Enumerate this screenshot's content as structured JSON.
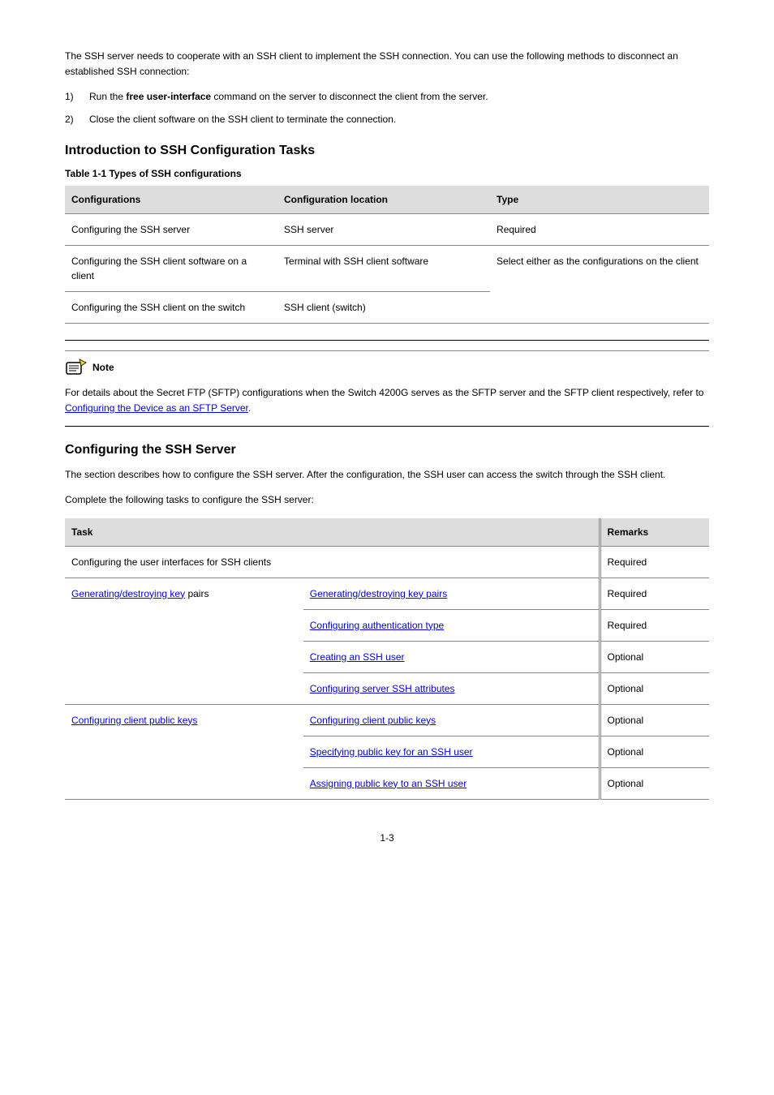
{
  "intro": {
    "p1": "The SSH server needs to cooperate with an SSH client to implement the SSH connection. You can use the following methods to disconnect an established SSH connection:",
    "items": [
      {
        "n": "1)",
        "text_prefix": "Run the ",
        "bold": "free user-interface",
        "text_suffix": " command on the server to disconnect the client from the server."
      },
      {
        "n": "2)",
        "text_prefix": "Close the client software on the SSH client to terminate the connection.",
        "bold": "",
        "text_suffix": ""
      }
    ]
  },
  "section1": {
    "heading": "Introduction to SSH Configuration Tasks",
    "table_caption": "Table 1-1 Types of SSH configurations",
    "table": {
      "headers": [
        "Configurations",
        "Configuration location",
        "Type"
      ],
      "rows": [
        [
          "Configuring the SSH server",
          "SSH server",
          "Required"
        ],
        [
          "Configuring the SSH client software on a client",
          "Terminal with SSH client software",
          "Select either as the configurations on the client"
        ],
        [
          "Configuring the SSH client on the switch",
          "SSH client (switch)",
          ""
        ]
      ]
    },
    "note_label": "Note",
    "note_p1": "For details about the Secret FTP (SFTP) configurations when the Switch 4200G serves as the SFTP server and the SFTP client respectively, refer to",
    "note_link": "Configuring the Device as an SFTP Server",
    "note_p2": "."
  },
  "section2": {
    "heading": "Configuring the SSH Server",
    "p1": "The section describes how to configure the SSH server. After the configuration, the SSH user can access the switch through the SSH client.",
    "p2": "Complete the following tasks to configure the SSH server:",
    "table": {
      "headers": [
        "Task",
        "",
        "Remarks"
      ],
      "rows": [
        {
          "task": "Configuring the user interfaces for SSH clients",
          "colspan": 2,
          "remarks": "Required"
        },
        {
          "task_link": "Generating/destroying key pairs",
          "sub_link": "Generating/destroying key pairs",
          "remarks": "Required"
        },
        {
          "task": "",
          "sub_link": "Configuring authentication type",
          "remarks": "Required"
        },
        {
          "task": "",
          "sub_link": "Creating an SSH user",
          "remarks": "Optional"
        },
        {
          "task": "",
          "sub_link": "Configuring server SSH attributes",
          "remarks": "Optional"
        },
        {
          "task_link": "Configuring client public keys",
          "sub_link": "Configuring client public keys",
          "remarks": "Optional"
        },
        {
          "task": "",
          "sub_link": "Specifying public key for an SSH user",
          "remarks": "Optional"
        },
        {
          "task": "",
          "sub_link": "Assigning public key to an SSH user",
          "remarks": "Optional"
        }
      ]
    }
  },
  "complete_table2": {
    "header_task": "Task",
    "header_remarks": "Remarks",
    "rows": [
      {
        "col1": "Configuring the user interfaces for SSH clients",
        "col2": "",
        "col3": "Required",
        "span": true
      },
      {
        "col1_link": "Generating/destroying key",
        "col1_plain": "pairs",
        "col2_link": "Generating/destroying key pairs",
        "col3": "Required"
      },
      {
        "col1": "",
        "col2_link": "Configuring authentication type",
        "col3": "Required"
      },
      {
        "col1": "",
        "col2_link": "Creating an SSH user",
        "col3": "Optional"
      },
      {
        "col1": "",
        "col2_link": "Configuring server SSH attributes",
        "col3": "Optional"
      },
      {
        "col1_link": "Configuring client public keys",
        "col2_link": "Configuring client public keys",
        "col3": "Optional"
      },
      {
        "col1": "",
        "col2_link": "Specifying public key for an SSH user",
        "col3": "Optional"
      },
      {
        "col1": "",
        "col2_link": "Assigning public key to an SSH user",
        "col3": "Optional"
      }
    ]
  },
  "table2_display": {
    "h_task": "Task",
    "h_remarks": "Remarks",
    "r0_c1": "Configuring the user interfaces for SSH clients",
    "r0_c3": "Required",
    "r1_c1_link": "Generating/destroying key",
    "r1_c1_rest": "pairs",
    "r1_c2_link": "Generating/destroying key pairs",
    "r1_c3": "Required",
    "r2_c2_link": "Configuring authentication type",
    "r2_c3": "Required",
    "r3_c2_link": "Creating an SSH user",
    "r3_c3": "Optional",
    "r4_c2_link": "Configuring server SSH attributes",
    "r4_c3": "Optional",
    "r5_c1_link": "Configuring client public keys",
    "r5_c2_link": "Configuring client public keys",
    "r5_c3": "Optional",
    "r6_c2_link": "Specifying public key for an SSH user",
    "r6_c3": "Optional",
    "r7_c2_link": "Assigning public key to an SSH user",
    "r7_c3": "Optional"
  },
  "page_number": "1-3"
}
